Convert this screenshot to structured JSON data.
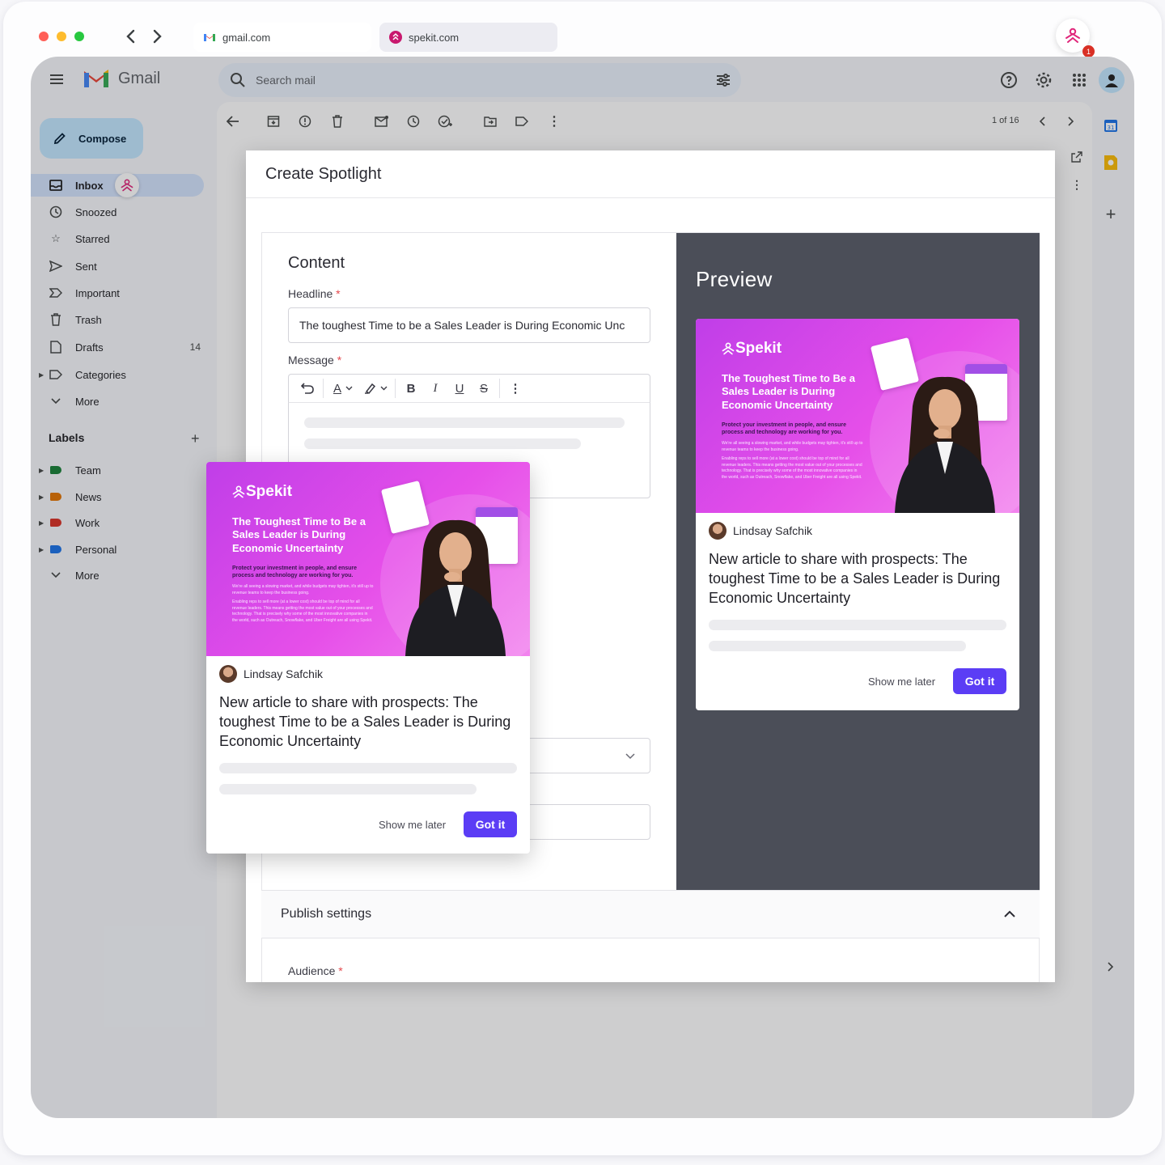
{
  "browser": {
    "tabs": [
      {
        "label": "gmail.com",
        "icon": "gmail-icon"
      },
      {
        "label": "spekit.com",
        "icon": "spekit-icon"
      }
    ],
    "spekit_badge": "1"
  },
  "gmail": {
    "app_name": "Gmail",
    "search_placeholder": "Search mail",
    "compose_label": "Compose",
    "nav": [
      {
        "label": "Inbox",
        "icon": "inbox-icon",
        "count": ""
      },
      {
        "label": "Snoozed",
        "icon": "clock-icon",
        "count": ""
      },
      {
        "label": "Starred",
        "icon": "star-icon",
        "count": ""
      },
      {
        "label": "Sent",
        "icon": "send-icon",
        "count": ""
      },
      {
        "label": "Important",
        "icon": "important-icon",
        "count": ""
      },
      {
        "label": "Trash",
        "icon": "trash-icon",
        "count": ""
      },
      {
        "label": "Drafts",
        "icon": "draft-icon",
        "count": "14"
      },
      {
        "label": "Categories",
        "icon": "label-icon",
        "count": ""
      },
      {
        "label": "More",
        "icon": "chevron-down-icon",
        "count": ""
      }
    ],
    "labels_heading": "Labels",
    "labels": [
      {
        "label": "Team",
        "color": "#188038"
      },
      {
        "label": "News",
        "color": "#e37400"
      },
      {
        "label": "Work",
        "color": "#d93025"
      },
      {
        "label": "Personal",
        "color": "#1a73e8"
      }
    ],
    "labels_more": "More",
    "pagination": "1 of 16"
  },
  "modal": {
    "title": "Create Spotlight",
    "content_heading": "Content",
    "headline_label": "Headline",
    "required_mark": "*",
    "headline_value": "The toughest Time to be a Sales Leader is During Economic Unc",
    "message_label": "Message",
    "preview_heading": "Preview",
    "publish_settings": "Publish settings",
    "audience_label": "Audience"
  },
  "spotlight_card": {
    "brand": "Spekit",
    "hero_title": "The Toughest Time to Be a Sales Leader is During Economic Uncertainty",
    "hero_subtitle": "Protect your investment in people, and ensure process and technology are working for you.",
    "hero_body_1": "We're all seeing a slowing market, and while budgets may tighten, it's still up to revenue teams to keep the business going.",
    "hero_body_2": "Enabling reps to sell more (at a lower cost) should be top of mind for all revenue leaders. This means getting the most value out of your processes and technology. That is precisely why some of the most innovative companies in the world, such as Outreach, Snowflake, and Uber Freight are all using Spekit.",
    "author": "Lindsay Safchik",
    "title": "New article to share with prospects: The toughest Time to be a Sales Leader is During Economic Uncertainty",
    "later_label": "Show me later",
    "got_it_label": "Got it"
  },
  "colors": {
    "accent": "#5b3df5",
    "preview_bg": "#4b4e58",
    "hero_pink": "#e64fe9",
    "inbox_active": "#d3e3fd"
  }
}
